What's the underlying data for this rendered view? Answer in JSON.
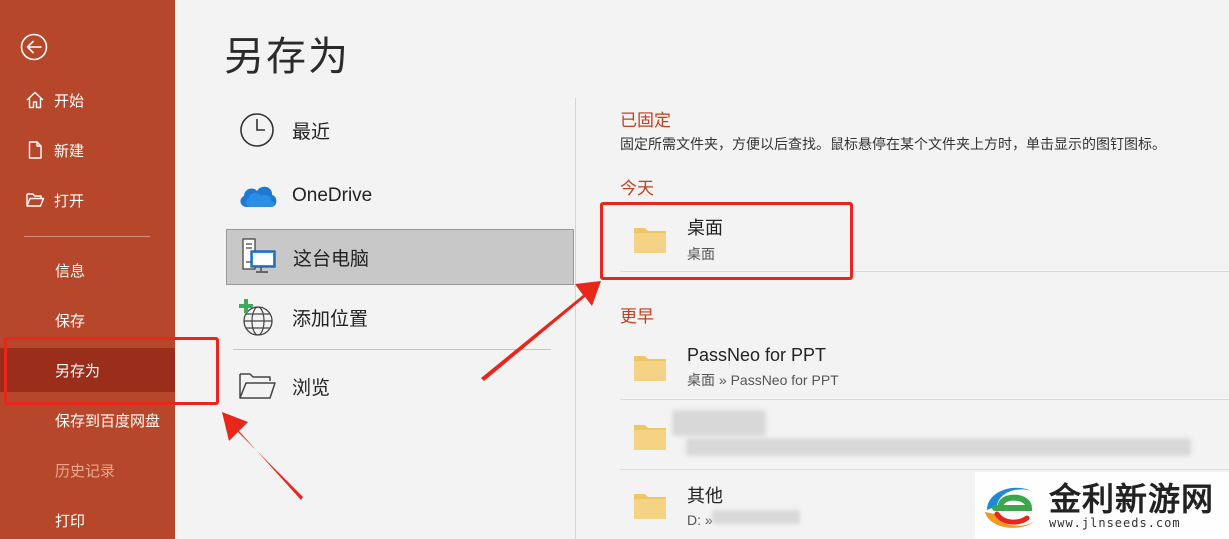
{
  "sidebar": {
    "items": [
      {
        "label": "开始",
        "icon": "home-icon"
      },
      {
        "label": "新建",
        "icon": "new-document-icon"
      },
      {
        "label": "打开",
        "icon": "open-folder-icon"
      },
      {
        "label": "信息"
      },
      {
        "label": "保存"
      },
      {
        "label": "另存为",
        "active": true
      },
      {
        "label": "保存到百度网盘"
      },
      {
        "label": "历史记录",
        "disabled": true
      },
      {
        "label": "打印"
      }
    ]
  },
  "page_title": "另存为",
  "locations": [
    {
      "label": "最近",
      "icon": "clock-icon"
    },
    {
      "label": "OneDrive",
      "icon": "onedrive-cloud-icon"
    },
    {
      "label": "这台电脑",
      "icon": "this-pc-icon",
      "selected": true
    },
    {
      "label": "添加位置",
      "icon": "add-location-icon"
    },
    {
      "label": "浏览",
      "icon": "browse-folder-icon"
    }
  ],
  "pinned": {
    "heading": "已固定",
    "description": "固定所需文件夹，方便以后查找。鼠标悬停在某个文件夹上方时，单击显示的图钉图标。"
  },
  "today": {
    "heading": "今天",
    "folders": [
      {
        "name": "桌面",
        "path": "桌面"
      }
    ]
  },
  "earlier": {
    "heading": "更早",
    "folders": [
      {
        "name": "PassNeo for PPT",
        "path": "桌面 » PassNeo for PPT"
      },
      {
        "name": "",
        "path": "",
        "blurred": true
      },
      {
        "name": "其他",
        "path": "D: »"
      }
    ]
  },
  "watermark": {
    "brand": "金利新游网",
    "url": "www.jlnseeds.com"
  },
  "colors": {
    "sidebar": "#b7472a",
    "sidebar_active": "#9b2d1b",
    "accent_heading": "#c0411f",
    "annotation_red": "#e8261c",
    "folder": "#f0c56a"
  }
}
